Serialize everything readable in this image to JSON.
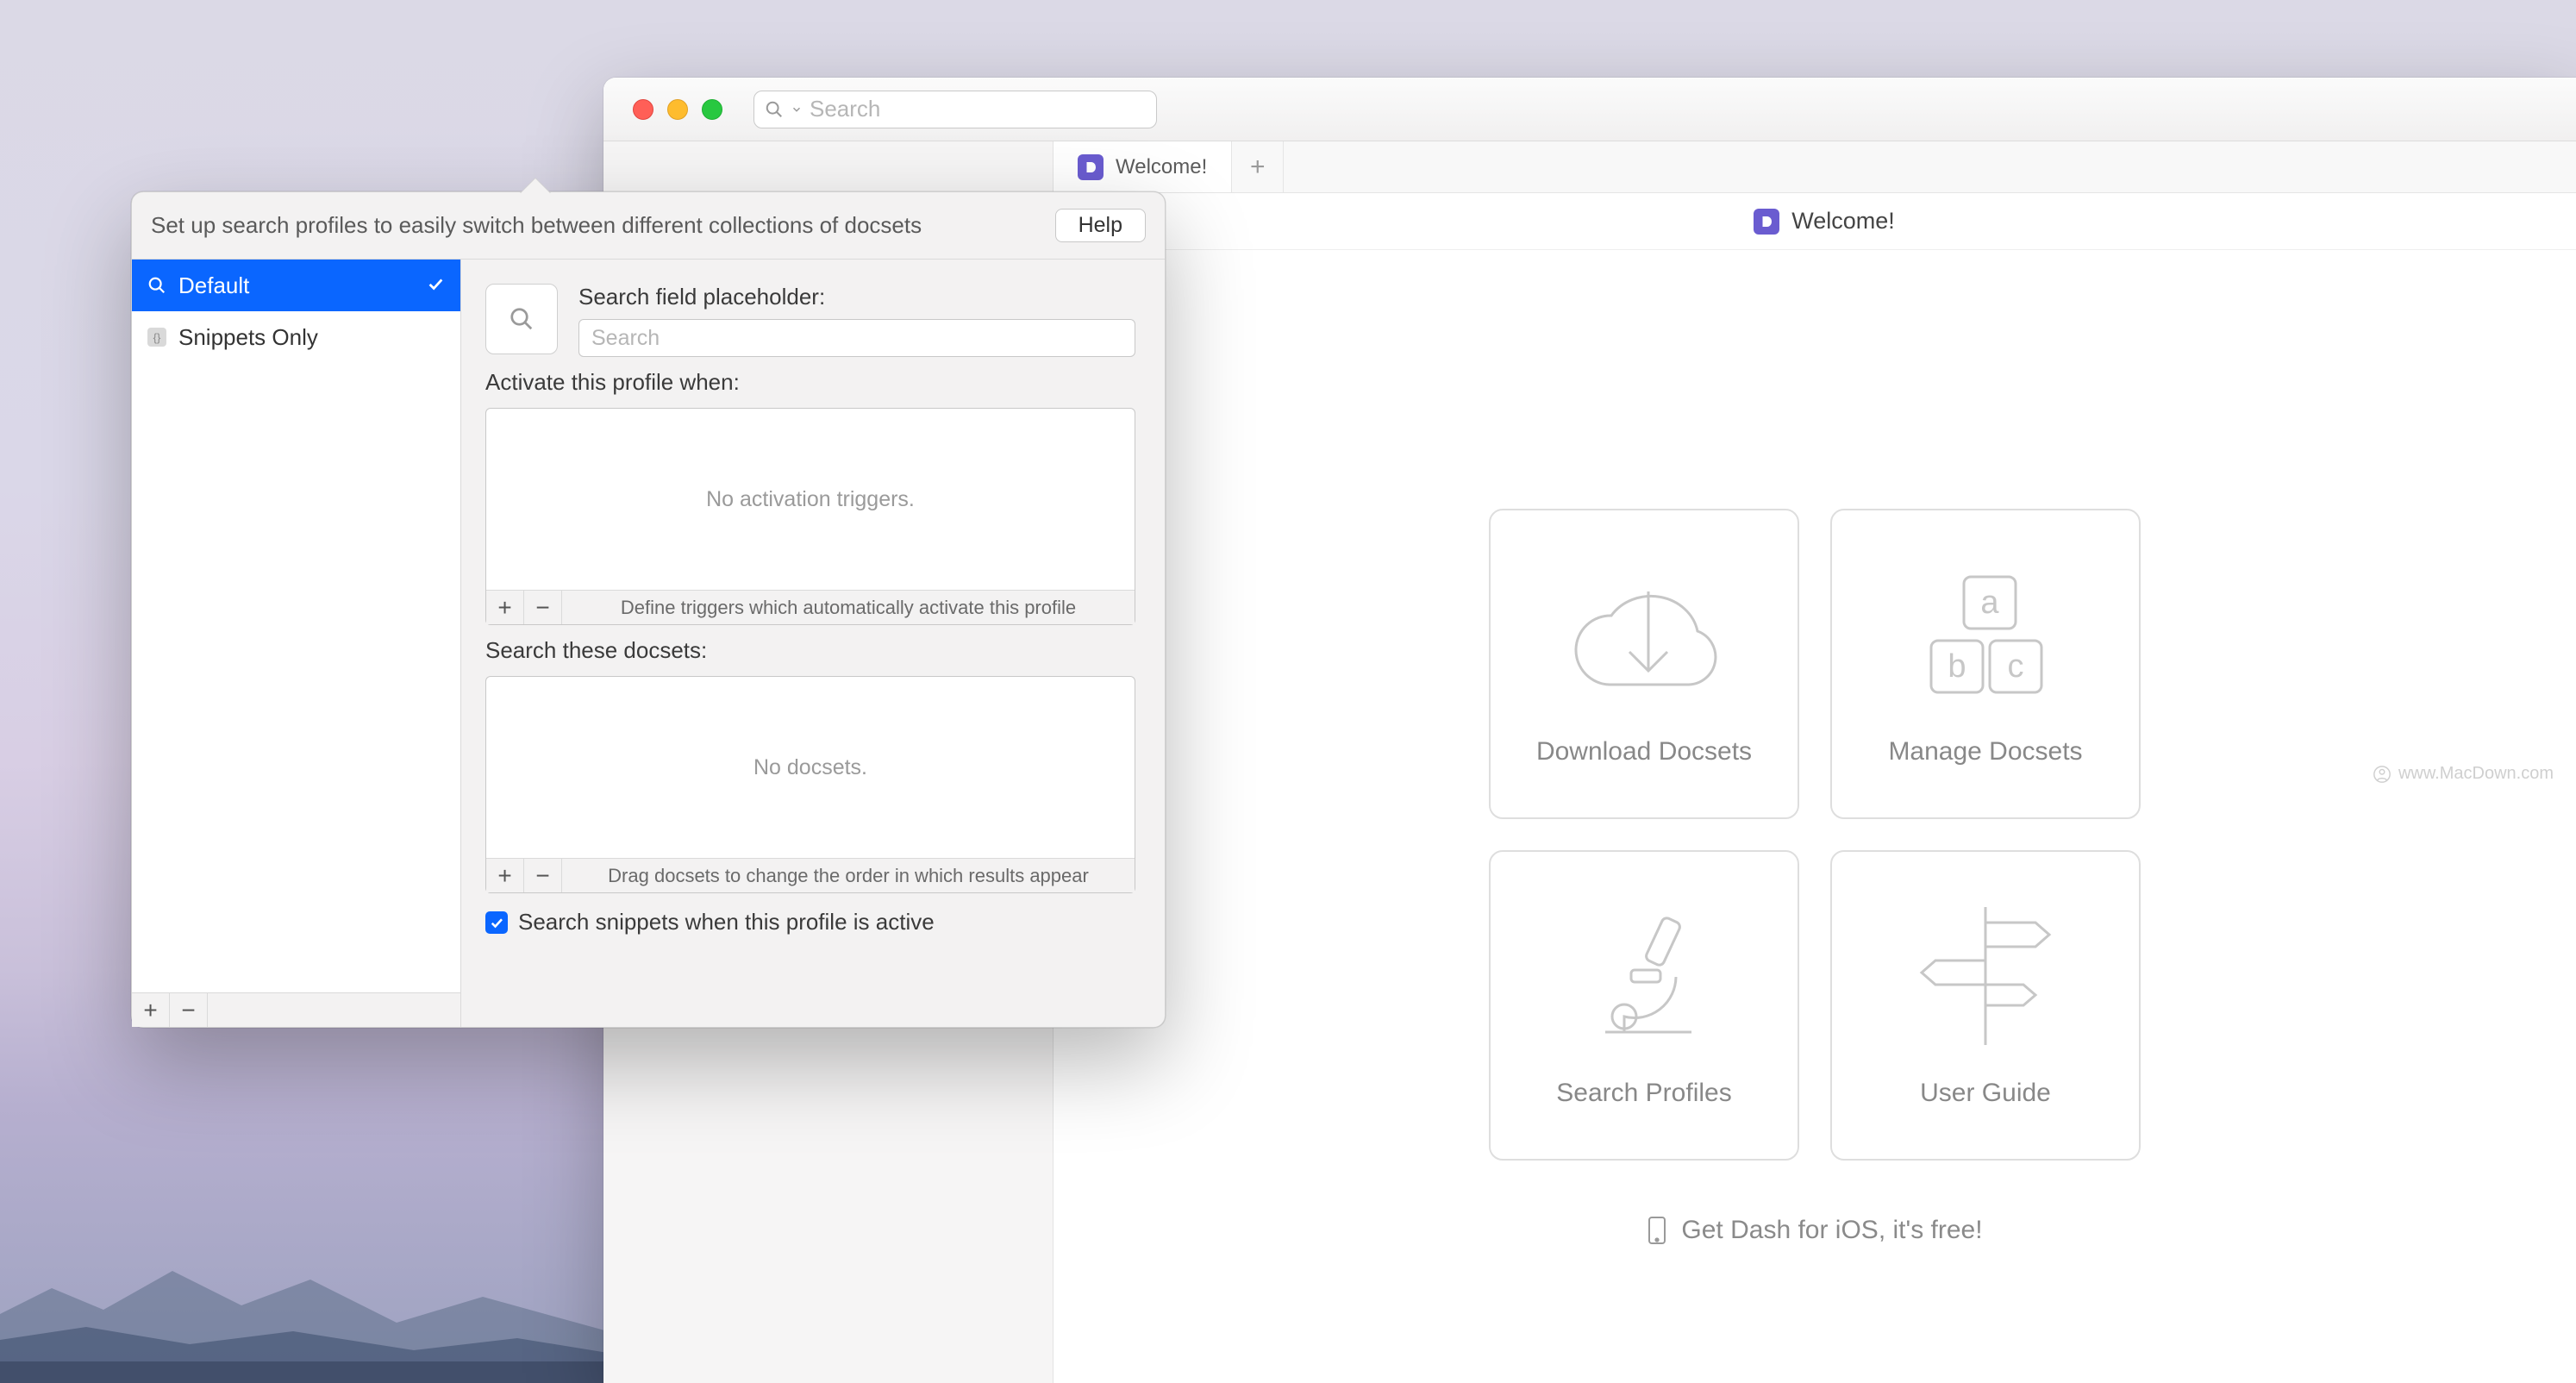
{
  "main": {
    "search_placeholder": "Search",
    "tab_label": "Welcome!",
    "page_title": "Welcome!",
    "cards": {
      "download": "Download Docsets",
      "manage": "Manage Docsets",
      "profiles": "Search Profiles",
      "guide": "User Guide"
    },
    "ios_link": "Get Dash for iOS, it's free!",
    "watermark": "www.MacDown.com"
  },
  "popover": {
    "header": "Set up search profiles to easily switch between different collections of docsets",
    "help": "Help",
    "profiles": {
      "default": "Default",
      "snippets": "Snippets Only"
    },
    "placeholder_label": "Search field placeholder:",
    "placeholder_value": "Search",
    "activate_label": "Activate this profile when:",
    "activate_empty": "No activation triggers.",
    "activate_hint": "Define triggers which automatically activate this profile",
    "docsets_label": "Search these docsets:",
    "docsets_empty": "No docsets.",
    "docsets_hint": "Drag docsets to change the order in which results appear",
    "snippets_checkbox": "Search snippets when this profile is active"
  }
}
